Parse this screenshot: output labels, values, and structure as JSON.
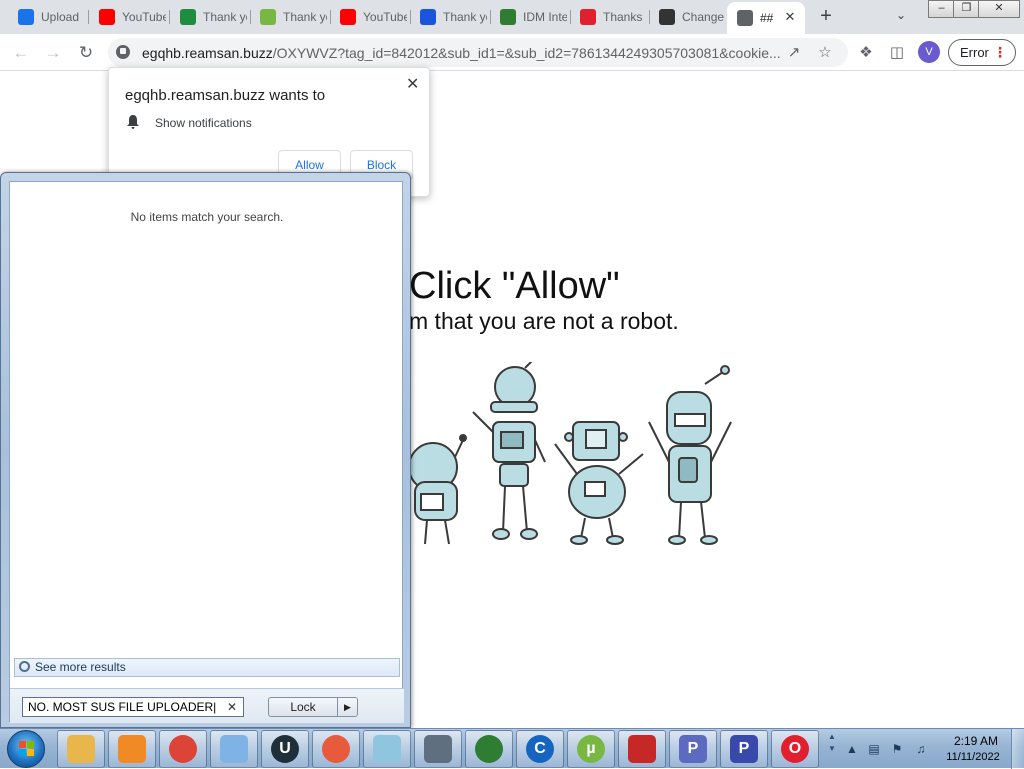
{
  "browser": {
    "tabs": [
      {
        "title": "Upload",
        "icon": "cloud-upload-icon",
        "color": "#1a73e8"
      },
      {
        "title": "YouTube",
        "icon": "youtube-icon",
        "color": "#ff0000"
      },
      {
        "title": "Thank you",
        "icon": "filehost-x-icon",
        "color": "#1e8e3e"
      },
      {
        "title": "Thank you",
        "icon": "utorrent-icon",
        "color": "#78b842"
      },
      {
        "title": "YouTube",
        "icon": "youtube-icon",
        "color": "#ff0000"
      },
      {
        "title": "Thank you",
        "icon": "brackets-icon",
        "color": "#1a56db"
      },
      {
        "title": "IDM Integration",
        "icon": "idm-globe-icon",
        "color": "#2e7d32"
      },
      {
        "title": "Thanks",
        "icon": "opera-icon",
        "color": "#e0202e"
      },
      {
        "title": "Change",
        "icon": "changelog-icon",
        "color": "#333333"
      },
      {
        "title": "##",
        "icon": "globe-icon",
        "color": "#5f6368",
        "active": true
      }
    ],
    "url_host": "egqhb.reamsan.buzz",
    "url_path": "/OXYWVZ?tag_id=842012&sub_id1=&sub_id2=7861344249305703081&cookie...",
    "profile_initial": "V",
    "error_label": "Error"
  },
  "permission_popup": {
    "title": "egqhb.reamsan.buzz wants to",
    "item": "Show notifications",
    "allow_label": "Allow",
    "block_label": "Block"
  },
  "page": {
    "headline": "Click \"Allow\"",
    "subline": "m that you are not a robot."
  },
  "start_menu": {
    "empty_message": "No items match your search.",
    "see_more": "See more results",
    "search_value": "NO. MOST SUS FILE UPLOADER",
    "lock_label": "Lock"
  },
  "taskbar": {
    "items": [
      {
        "name": "file-explorer",
        "icon": "folder-icon",
        "color": "#e8b64a"
      },
      {
        "name": "media-player",
        "icon": "media-player-icon",
        "color": "#f08a24"
      },
      {
        "name": "chrome",
        "icon": "chrome-icon",
        "color": "#db4437"
      },
      {
        "name": "paint",
        "icon": "paint-palette-icon",
        "color": "#7fb2e5"
      },
      {
        "name": "uppercut",
        "icon": "u-circle-icon",
        "color": "#1f2f3a"
      },
      {
        "name": "speedtest",
        "icon": "gauge-icon",
        "color": "#e85a3c"
      },
      {
        "name": "notepad",
        "icon": "notepad-icon",
        "color": "#8fc5df"
      },
      {
        "name": "uploader",
        "icon": "upload-bag-icon",
        "color": "#5f6f7f"
      },
      {
        "name": "idm",
        "icon": "idm-globe-icon",
        "color": "#2e7d32"
      },
      {
        "name": "ccleaner",
        "icon": "c-circle-icon",
        "color": "#1565c0"
      },
      {
        "name": "utorrent",
        "icon": "utorrent-icon",
        "color": "#78b842"
      },
      {
        "name": "screen-recorder",
        "icon": "video-camera-icon",
        "color": "#c62828"
      },
      {
        "name": "pdf-app-1",
        "icon": "p-letter-icon",
        "color": "#5c6bc0"
      },
      {
        "name": "pdf-app-2",
        "icon": "p-letter-icon",
        "color": "#3949ab"
      },
      {
        "name": "opera",
        "icon": "opera-icon",
        "color": "#e0202e"
      }
    ],
    "clock_time": "2:19 AM",
    "clock_date": "11/11/2022"
  }
}
